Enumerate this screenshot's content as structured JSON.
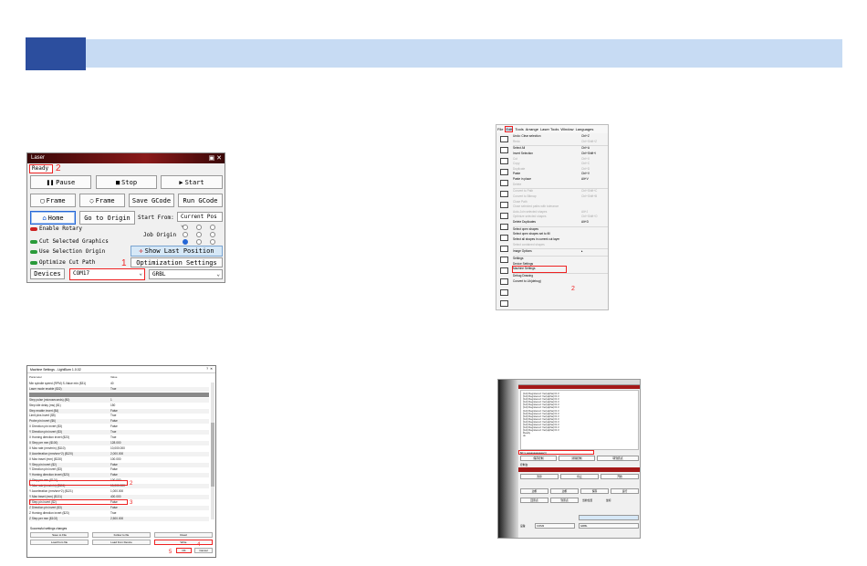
{
  "laser": {
    "title": "Laser",
    "status": "Ready",
    "pause": "Pause",
    "stop": "Stop",
    "start": "Start",
    "frame1": "Frame",
    "frame2": "Frame",
    "save_gcode": "Save GCode",
    "run_gcode": "Run GCode",
    "home": "Home",
    "go_to_origin": "Go to Origin",
    "start_from_label": "Start From:",
    "start_from_value": "Current Pos",
    "enable_rotary": "Enable Rotary",
    "job_origin": "Job Origin",
    "cut_selected": "Cut Selected Graphics",
    "use_selection_origin": "Use Selection Origin",
    "show_last_position": "Show Last Position",
    "optimize_cut_path": "Optimize Cut Path",
    "optimization_settings": "Optimization Settings",
    "devices_label": "Devices",
    "port": "COM17",
    "device": "GRBL",
    "marker1": "1",
    "marker2": "2"
  },
  "edit_menu": {
    "menubar": [
      "File",
      "Edit",
      "Tools",
      "Arrange",
      "Laser Tools",
      "Window",
      "Languages"
    ],
    "items": [
      {
        "label": "Undo: Clear selection",
        "key": "Ctrl+Z",
        "disabled": false
      },
      {
        "label": "Redo",
        "key": "Ctrl+Shift+Z",
        "disabled": true
      },
      {
        "sep": true
      },
      {
        "label": "Select All",
        "key": "Ctrl+A",
        "disabled": false
      },
      {
        "label": "Invert Selection",
        "key": "Ctrl+Shift+I",
        "disabled": false
      },
      {
        "label": "Cut",
        "key": "Ctrl+X",
        "disabled": true
      },
      {
        "label": "Copy",
        "key": "Ctrl+C",
        "disabled": true
      },
      {
        "label": "Duplicate",
        "key": "Ctrl+D",
        "disabled": true
      },
      {
        "label": "Paste",
        "key": "Ctrl+V",
        "disabled": false
      },
      {
        "label": "Paste in place",
        "key": "Alt+V",
        "disabled": false
      },
      {
        "label": "Delete",
        "key": "",
        "disabled": true
      },
      {
        "sep": true
      },
      {
        "label": "Convert to Path",
        "key": "Ctrl+Shift+C",
        "disabled": true
      },
      {
        "label": "Convert to Bitmap",
        "key": "Ctrl+Shift+B",
        "disabled": true
      },
      {
        "label": "Close Path",
        "key": "",
        "disabled": true
      },
      {
        "label": "Close selected paths with tolerance",
        "key": "",
        "disabled": true
      },
      {
        "label": "Auto-Join selected shapes",
        "key": "Alt+J",
        "disabled": true
      },
      {
        "label": "Optimize selected shapes",
        "key": "Ctrl+Shift+O",
        "disabled": true
      },
      {
        "label": "Delete Duplicates",
        "key": "Alt+D",
        "disabled": false
      },
      {
        "sep": true
      },
      {
        "label": "Select open shapes",
        "key": "",
        "disabled": false
      },
      {
        "label": "Select open shapes set to fill",
        "key": "",
        "disabled": false
      },
      {
        "label": "Select all shapes in current cut layer",
        "key": "",
        "disabled": false
      },
      {
        "label": "Select contained shapes",
        "key": "",
        "disabled": true
      },
      {
        "sep": true
      },
      {
        "label": "Image Options",
        "key": "▸",
        "disabled": false
      },
      {
        "sep": true
      },
      {
        "label": "Settings",
        "key": "",
        "disabled": false
      },
      {
        "label": "Device Settings",
        "key": "",
        "disabled": false
      },
      {
        "label": "Machine Settings",
        "key": "",
        "disabled": false
      },
      {
        "sep": true
      },
      {
        "label": "Debug Drawing",
        "key": "",
        "disabled": false
      },
      {
        "label": "Convert to Lib(debug)",
        "key": "",
        "disabled": false
      }
    ],
    "marker": "2"
  },
  "machine_settings": {
    "title": "Machine Settings - LightBurn 1.0.02",
    "col_param": "Parameter",
    "col_value": "Value",
    "rows": [
      {
        "p": "Min spindle speed (RPM) S-Value min ($31)",
        "v": "40"
      },
      {
        "p": "Laser mode enable ($32)",
        "v": "True"
      },
      {
        "p": "",
        "v": "",
        "gray": true
      },
      {
        "p": "Step pulse (microseconds) ($0)",
        "v": "1"
      },
      {
        "p": "Step idle delay (ms) ($1)",
        "v": "150"
      },
      {
        "p": "Step enable invert ($4)",
        "v": "False"
      },
      {
        "p": "Limit pins invert ($5)",
        "v": "True"
      },
      {
        "p": "Probe pin invert ($6)",
        "v": "False"
      },
      {
        "p": "X Direction pin invert ($3)",
        "v": "False"
      },
      {
        "p": "Y Direction pin invert ($3)",
        "v": "True"
      },
      {
        "p": "X Homing direction invert ($23)",
        "v": "True"
      },
      {
        "p": "X Step per mm ($100)",
        "v": "128.000"
      },
      {
        "p": "X Max rate (mm/min) ($110)",
        "v": "10,000.000"
      },
      {
        "p": "X Acceleration (mm/sec^2) ($120)",
        "v": "2,000.000"
      },
      {
        "p": "X Max travel (mm) ($130)",
        "v": "100.000"
      },
      {
        "p": "Y Step pin invert ($2)",
        "v": "False"
      },
      {
        "p": "Y Direction pin invert ($3)",
        "v": "False"
      },
      {
        "p": "Y Homing direction invert ($23)",
        "v": "False"
      },
      {
        "p": "Y Step per mm ($101)",
        "v": "100.000"
      },
      {
        "p": "Y Max rate (mm/min) ($111)",
        "v": "10,000.000"
      },
      {
        "p": "Y Acceleration (mm/sec^2) ($121)",
        "v": "1,000.000"
      },
      {
        "p": "Y Max travel (mm) ($131)",
        "v": "400.000"
      },
      {
        "p": "Z Step pin invert ($2)",
        "v": "False"
      },
      {
        "p": "Z Direction pin invert ($3)",
        "v": "False"
      },
      {
        "p": "Z Homing direction invert ($23)",
        "v": "True"
      },
      {
        "p": "Z Step per mm ($102)",
        "v": "2,500.000"
      }
    ],
    "footer": "Successful settings changes",
    "save_to_file": "Save to File",
    "follow_to_file": "Follow to file",
    "read": "Read",
    "load_from_file": "Load from file",
    "load_from_device": "Load from Device",
    "write": "Write",
    "ok": "OK",
    "cancel": "Cancel",
    "marker2": "2",
    "marker3": "3",
    "marker4": "4",
    "marker5": "5"
  },
  "log_screen": {
    "console_lines": [
      "[G4] Registered: Ver(alpha)=0.3",
      "[G4] Registered: Ver(alpha)=0.3",
      "[G4] Registered: Ver(alpha)=0.3",
      "[G4] Registered: Ver(alpha)=0.3",
      "[G4] Registered: Ver(alpha)=0.3",
      "[G4] Registered: Ver(alpha)=0.3",
      "[G4] Registered: Ver(alpha)=0.3",
      "[G4] Registered: Ver(alpha)=0.3",
      "[G4] Registered: Ver(alpha)=0.3",
      "[G4] Registered: Ver(alpha)=0.3",
      "[G4] Registered: Ver(alpha)=0.3",
      "[G4] Registered: Ver(alpha)=0.3",
      "[G4] Registered: Ver(alpha)=0.3",
      "[G4] Registered: Ver(alpha)=0.3",
      "Ready",
      "ok"
    ],
    "input": "$0=x,aaaaaaaaaaaa(=)",
    "btn_a": "保存控制",
    "btn_b": "清除控制",
    "btn_c": "转到原点",
    "tab1": "控制台",
    "pause": "暂停",
    "stop": "停止",
    "start": "开始",
    "frame1": "边框",
    "frame2": "边框",
    "save": "保存",
    "run": "运行",
    "home": "回原点",
    "origin": "到原点",
    "pos1": "当前位置",
    "pos2": "坐标",
    "status": "设备",
    "port": "COM3",
    "device": "GRBL"
  }
}
